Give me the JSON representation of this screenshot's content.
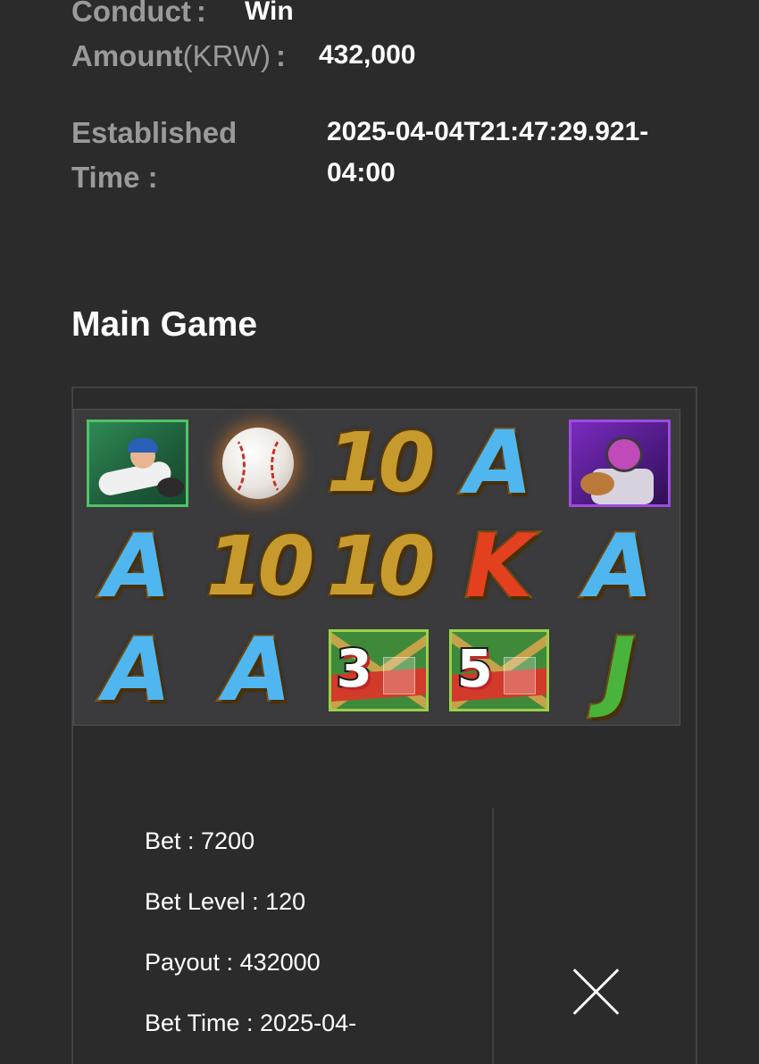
{
  "details": {
    "conduct_label": "Conduct",
    "conduct_colon": ":",
    "conduct_value": "Win",
    "amount_label": "Amount",
    "amount_unit": "(KRW)",
    "amount_colon": ":",
    "amount_value": "432,000",
    "established_label_line1": "Established",
    "established_label_line2": "Time :",
    "established_value_line1": "2025-04-04T21:47:29.921-",
    "established_value_line2": "04:00"
  },
  "main_game": {
    "title": "Main Game",
    "reels": [
      [
        "batter-card",
        "baseball",
        "10",
        "A",
        "catcher-card"
      ],
      [
        "A",
        "10",
        "10",
        "K",
        "A"
      ],
      [
        "A",
        "A",
        "scatter-3",
        "scatter-5",
        "J"
      ]
    ],
    "symbol_labels": {
      "ten": "10",
      "a": "A",
      "k": "K",
      "j": "J",
      "scatter_3": "3",
      "scatter_5": "5"
    },
    "symbol_colors": {
      "A": "#4fb6ef",
      "K": "#e2401f",
      "J": "#49b33c",
      "10": "#c79a2e"
    }
  },
  "summary": {
    "bet": "Bet : 7200",
    "bet_level": "Bet Level : 120",
    "payout": "Payout : 432000",
    "bet_time": "Bet Time : 2025-04-"
  },
  "icons": {
    "close": "close-icon"
  }
}
